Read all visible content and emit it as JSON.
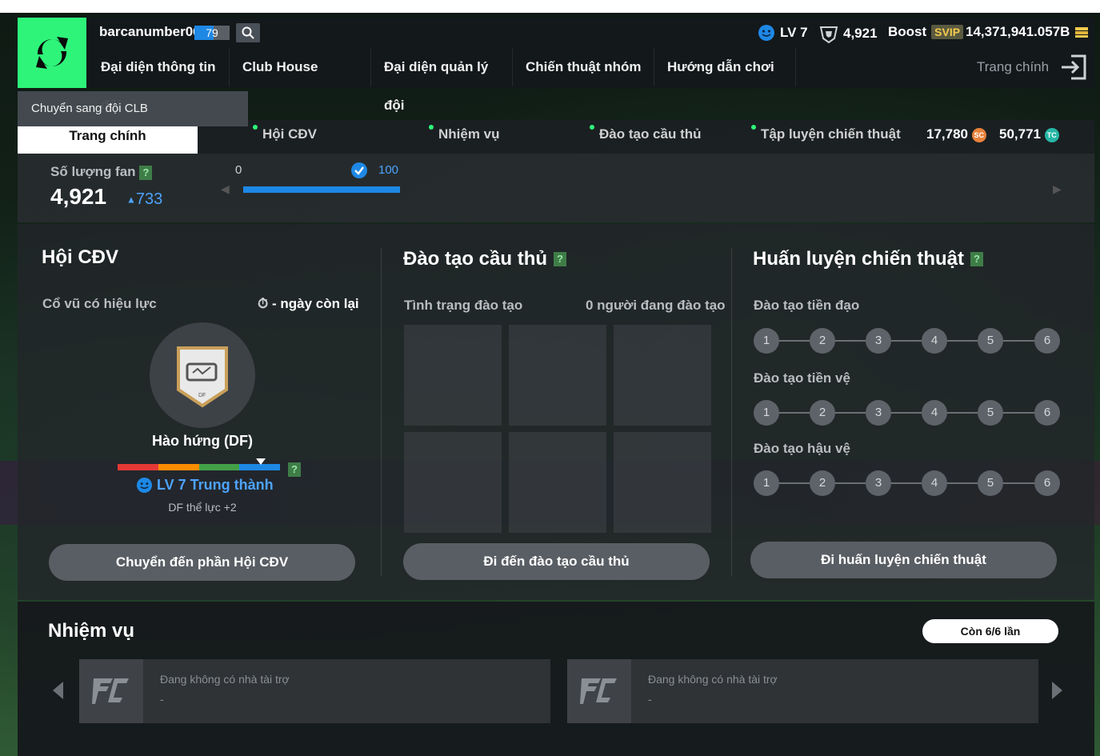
{
  "header": {
    "username": "barcanumber06",
    "user_level": "79",
    "account_level": "LV 7",
    "fans": "4,921",
    "boost_label": "Boost",
    "svip_label": "SVIP",
    "coins": "14,371,941.057B"
  },
  "nav": {
    "items": [
      "Đại diện thông tin đội",
      "Club House",
      "Đại diện quản lý đội",
      "Chiến thuật nhóm",
      "Hướng dẫn chơi"
    ],
    "home": "Trang chính"
  },
  "dropdown": {
    "label": "Chuyển sang đội CLB"
  },
  "tabs": {
    "active": "Trang chính",
    "items": [
      "Hội CĐV",
      "Nhiệm vụ",
      "Đào tạo cầu thủ",
      "Tập luyện chiến thuật"
    ],
    "currency_sc": "17,780",
    "currency_tc": "50,771",
    "sc_icon": "SC",
    "tc_icon": "TC"
  },
  "fan_summary": {
    "label": "Số lượng fan",
    "value": "4,921",
    "delta": "733",
    "progress_min": "0",
    "progress_max": "100",
    "progress_fraction": 1.0
  },
  "fan_club": {
    "title": "Hội CĐV",
    "subtitle": "Cổ vũ có hiệu lực",
    "days_left": "- ngày còn lại",
    "badge_pos": "DF",
    "badge_name": "Hào hứng (DF)",
    "level_text": "LV 7 Trung thành",
    "effect": "DF thể lực +2",
    "button": "Chuyển đến phần Hội CĐV",
    "meter_marker_fraction": 0.88
  },
  "training": {
    "title": "Đào tạo cầu thủ",
    "status_label": "Tình trạng đào tạo",
    "count_label": "0 người đang đào tạo",
    "button": "Đi đến đào tạo cầu thủ"
  },
  "tactics": {
    "title": "Huấn luyện chiến thuật",
    "rows": [
      {
        "label": "Đào tạo tiền đạo",
        "steps": [
          "1",
          "2",
          "3",
          "4",
          "5",
          "6"
        ]
      },
      {
        "label": "Đào tạo tiền vệ",
        "steps": [
          "1",
          "2",
          "3",
          "4",
          "5",
          "6"
        ]
      },
      {
        "label": "Đào tạo hậu vệ",
        "steps": [
          "1",
          "2",
          "3",
          "4",
          "5",
          "6"
        ]
      }
    ],
    "button": "Đi huấn luyện chiến thuật"
  },
  "missions": {
    "title": "Nhiệm vụ",
    "remaining": "Còn 6/6 lần",
    "cards": [
      {
        "text": "Đang không có nhà tài trợ",
        "sub": "-"
      },
      {
        "text": "Đang không có nhà tài trợ",
        "sub": "-"
      }
    ]
  },
  "colors": {
    "accent_green": "#2ef57a",
    "progress_blue": "#1e88e5",
    "meter": [
      "#e53935",
      "#fb8c00",
      "#43a047",
      "#1e88e5"
    ]
  }
}
